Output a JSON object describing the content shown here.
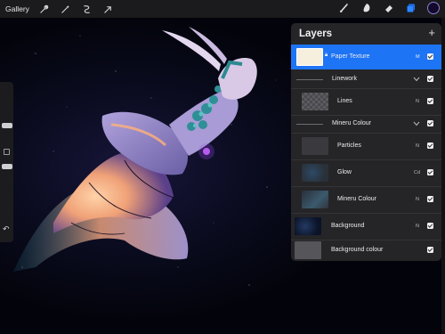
{
  "toolbar": {
    "gallery_label": "Gallery",
    "left_icons": [
      "wrench-icon",
      "magic-wand-icon",
      "selection-icon",
      "transform-arrow-icon"
    ],
    "right_icons": [
      "brush-icon",
      "smudge-icon",
      "eraser-icon",
      "layers-icon"
    ],
    "active_tool": "layers",
    "current_color": "#12082b"
  },
  "sidebar": {
    "undo_label": "↶"
  },
  "layers_panel": {
    "title": "Layers",
    "add_label": "+",
    "accent_color": "#1d74f5",
    "layers": [
      {
        "name": "Paper Texture",
        "mode": "M",
        "visible": true,
        "selected": true,
        "locked": true,
        "thumb": "paper"
      },
      {
        "name": "Linework",
        "group": true,
        "expanded": true
      },
      {
        "name": "Lines",
        "mode": "N",
        "visible": true,
        "thumb": "checker"
      },
      {
        "name": "Mineru Colour",
        "group": true,
        "expanded": true
      },
      {
        "name": "Particles",
        "mode": "N",
        "visible": true,
        "thumb": "dark"
      },
      {
        "name": "Glow",
        "mode": "Cd",
        "visible": true,
        "thumb": "glow"
      },
      {
        "name": "Mineru Colour",
        "mode": "N",
        "visible": true,
        "thumb": "mineru"
      },
      {
        "name": "Background",
        "mode": "N",
        "visible": true,
        "thumb": "bg"
      },
      {
        "name": "Background colour",
        "visible": true,
        "thumb": "bgcol"
      }
    ]
  }
}
